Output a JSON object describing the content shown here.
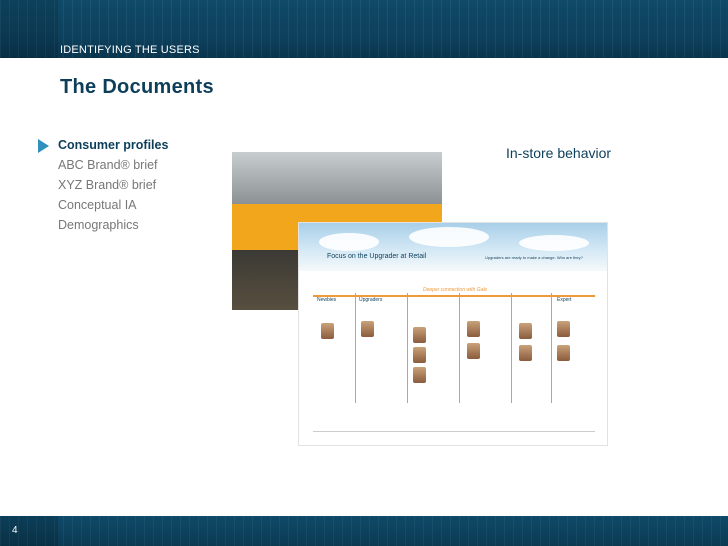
{
  "header": {
    "section_label": "IDENTIFYING THE USERS",
    "title": "The Documents"
  },
  "nav": {
    "items": [
      {
        "label": "Consumer profiles",
        "active": true
      },
      {
        "label": "ABC Brand® brief",
        "active": false
      },
      {
        "label": "XYZ Brand® brief",
        "active": false
      },
      {
        "label": "Conceptual IA",
        "active": false
      },
      {
        "label": "Demographics",
        "active": false
      }
    ]
  },
  "caption": "In-store behavior",
  "thumbnail": {
    "title": "Focus on the Upgrader at Retail",
    "subtitle": "Upgraders are ready to make a change. Who are they?",
    "arrow_text": "Deeper connection with Gale",
    "stages": [
      "Newbies",
      "Upgraders",
      "Expert"
    ]
  },
  "footer": {
    "page_number": "4"
  },
  "colors": {
    "brand_dark": "#0d3f5b",
    "accent_blue": "#2f8fbd",
    "accent_orange": "#ef9a3a"
  }
}
